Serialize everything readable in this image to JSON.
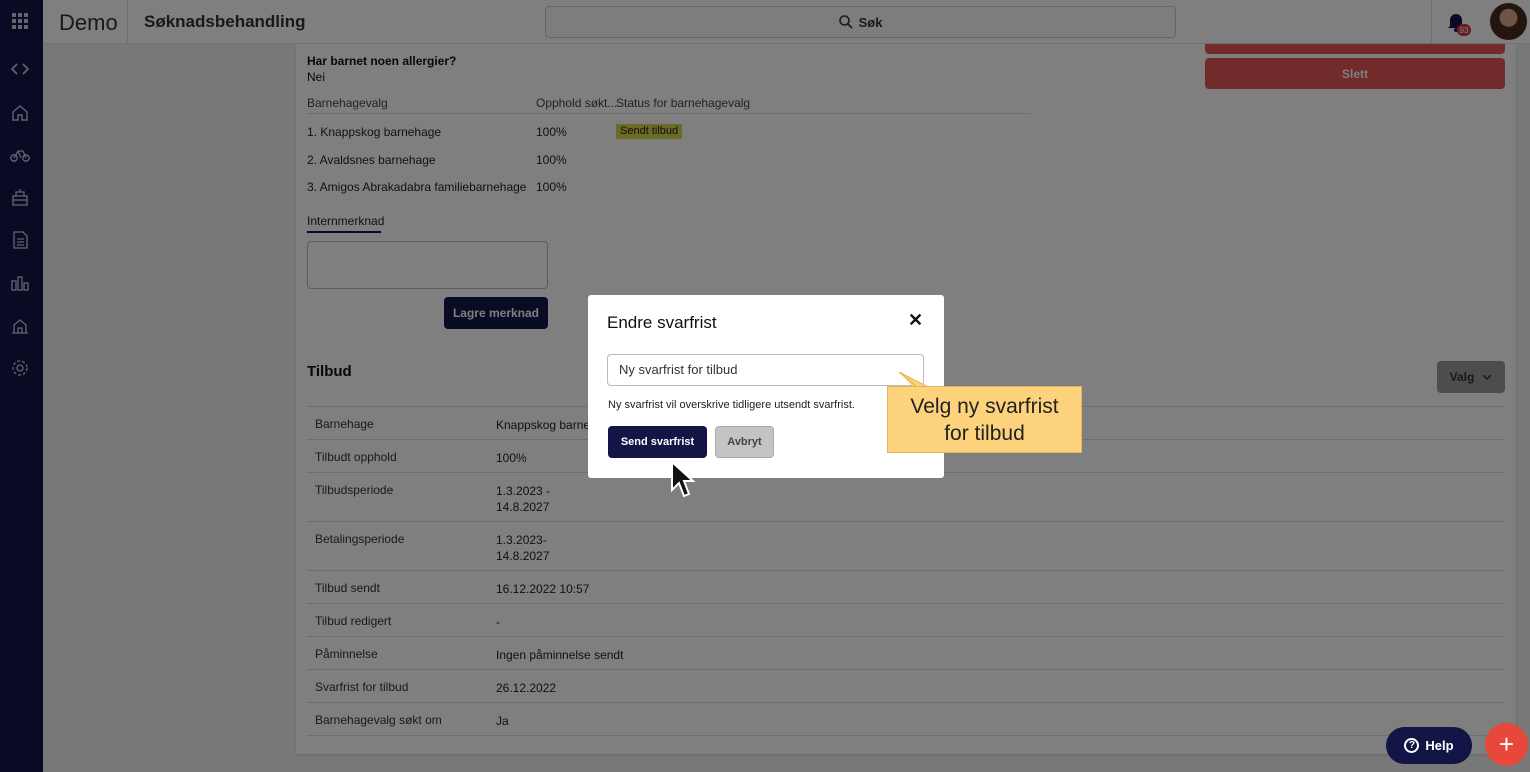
{
  "topbar": {
    "brand": "Demo",
    "page_title": "Søknadsbehandling",
    "search_label": "Søk",
    "notification_count": "93"
  },
  "sidebar": {
    "icons": [
      "grid-icon",
      "code-icon",
      "home-icon",
      "bicycle-icon",
      "school-icon",
      "document-icon",
      "chart-icon",
      "building-icon",
      "gear-icon"
    ]
  },
  "application": {
    "allergy_question": "Har barnet noen allergier?",
    "allergy_answer": "Nei",
    "delete_label": "Slett",
    "choices_table": {
      "headers": [
        "Barnehagevalg",
        "Opphold søkt...",
        "Status for barnehagevalg"
      ],
      "rows": [
        {
          "name": "1. Knappskog barnehage",
          "percent": "100%",
          "status": "Sendt tilbud"
        },
        {
          "name": "2. Avaldsnes barnehage",
          "percent": "100%",
          "status": ""
        },
        {
          "name": "3. Amigos Abrakadabra familiebarnehage",
          "percent": "100%",
          "status": ""
        }
      ]
    },
    "note_tab": "Internmerknad",
    "save_note_label": "Lagre merknad"
  },
  "offer": {
    "title": "Tilbud",
    "valg_label": "Valg",
    "rows": [
      {
        "key": "Barnehage",
        "value": "Knappskog barnehage"
      },
      {
        "key": "Tilbudt opphold",
        "value": "100%"
      },
      {
        "key": "Tilbudsperiode",
        "value": "1.3.2023 -",
        "value2": "14.8.2027"
      },
      {
        "key": "Betalingsperiode",
        "value": "1.3.2023-",
        "value2": "14.8.2027"
      },
      {
        "key": "Tilbud sendt",
        "value": "16.12.2022 10:57"
      },
      {
        "key": "Tilbud redigert",
        "value": "-"
      },
      {
        "key": "Påminnelse",
        "value": "Ingen påminnelse sendt"
      },
      {
        "key": "Svarfrist for tilbud",
        "value": "26.12.2022"
      },
      {
        "key": "Barnehagevalg søkt om",
        "value": "Ja"
      }
    ]
  },
  "modal": {
    "title": "Endre svarfrist",
    "input_placeholder": "Ny svarfrist for tilbud",
    "hint": "Ny svarfrist vil overskrive tidligere utsendt svarfrist.",
    "send_label": "Send svarfrist",
    "cancel_label": "Avbryt"
  },
  "callout": {
    "line1": "Velg ny svarfrist",
    "line2": "for tilbud"
  },
  "floating": {
    "help_label": "Help"
  },
  "colors": {
    "navy": "#131546",
    "danger": "#e25656",
    "tag": "#d8d64a",
    "callout": "#fdd27c"
  }
}
